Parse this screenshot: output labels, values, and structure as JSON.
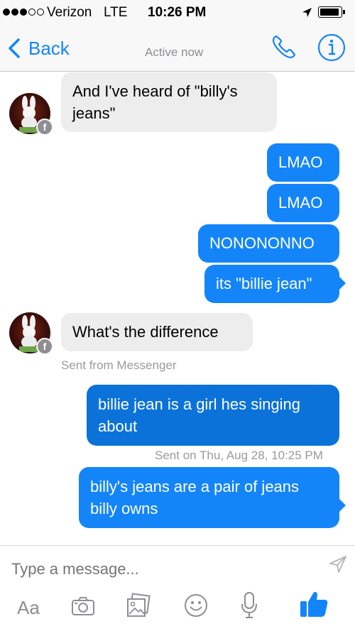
{
  "status": {
    "carrier": "Verizon",
    "network": "LTE",
    "time": "10:26 PM"
  },
  "nav": {
    "back_label": "Back",
    "subtitle": "Active now"
  },
  "messages": [
    {
      "dir": "in",
      "lines": [
        "And I've heard of \"billy's",
        "jeans\""
      ]
    },
    {
      "dir": "out",
      "lines": [
        "LMAO"
      ]
    },
    {
      "dir": "out",
      "lines": [
        "LMAO"
      ]
    },
    {
      "dir": "out",
      "lines": [
        "NONONONNO"
      ]
    },
    {
      "dir": "out",
      "lines": [
        "its \"billie jean\""
      ]
    },
    {
      "dir": "in",
      "lines": [
        "What's the difference"
      ]
    },
    {
      "dir": "out",
      "lines": [
        "billie jean is a girl hes singing",
        "about"
      ]
    },
    {
      "dir": "out",
      "lines": [
        "billy's jeans are a pair of jeans",
        "billy owns"
      ]
    }
  ],
  "meta": {
    "sent_from": "Sent from Messenger",
    "sent_on": "Sent on Thu, Aug 28, 10:25 PM"
  },
  "composer": {
    "placeholder": "Type a message...",
    "aa_label": "Aa"
  },
  "colors": {
    "accent": "#1485f9",
    "incoming_bubble": "#ededed"
  },
  "icons": [
    "phone-icon",
    "info-icon",
    "send-icon",
    "camera-icon",
    "gallery-icon",
    "emoji-icon",
    "microphone-icon",
    "thumbs-up-icon"
  ]
}
